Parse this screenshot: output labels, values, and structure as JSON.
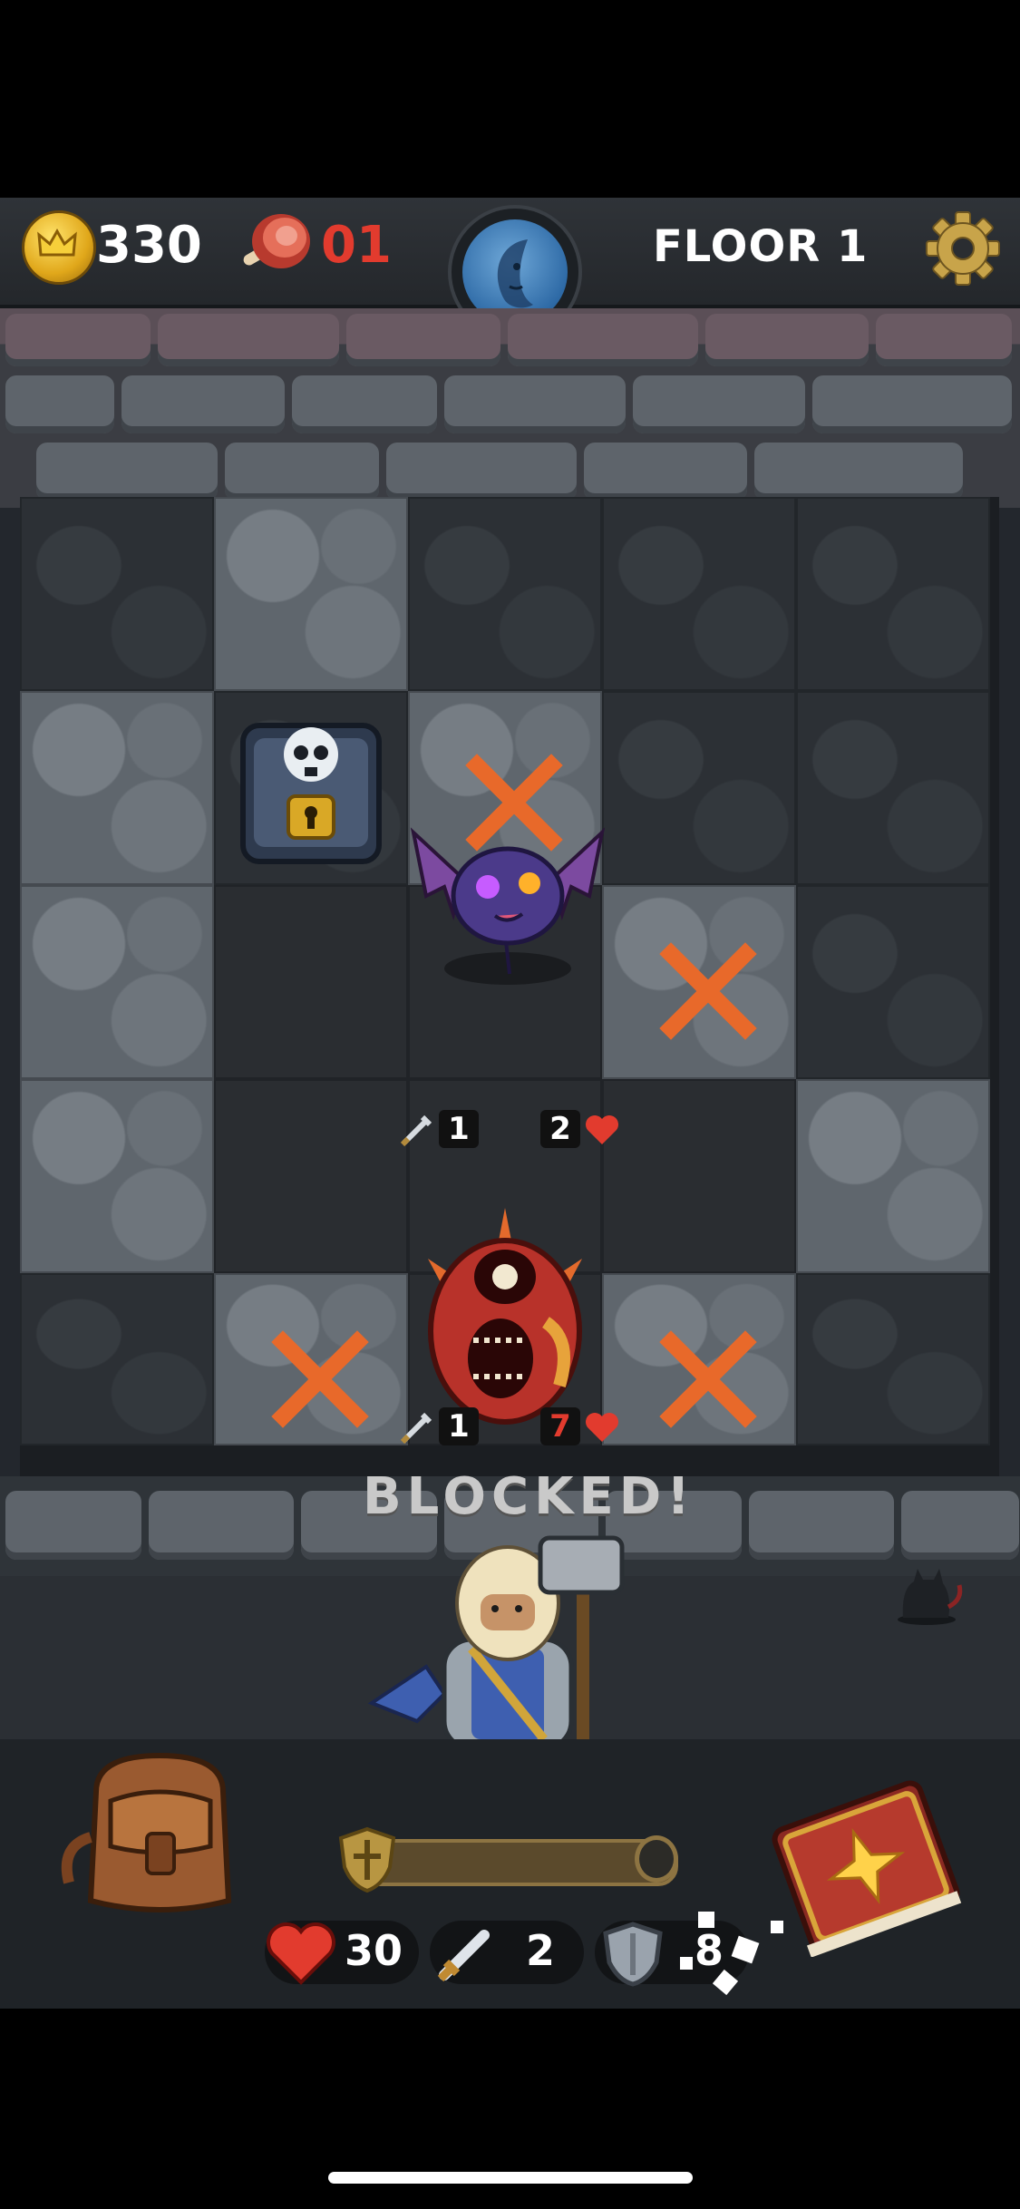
{
  "hud": {
    "gold": "330",
    "food": "01",
    "floor_label": "FLOOR 1"
  },
  "board": {
    "status_text": "BLOCKED!",
    "bat": {
      "attack": "1",
      "health": "2"
    },
    "slime": {
      "attack": "1",
      "health": "7"
    }
  },
  "player": {
    "health": "30",
    "attack": "2",
    "armor": "8"
  },
  "colors": {
    "health_red": "#e23b2e",
    "danger_x": "#e8692a",
    "background": "#23272d"
  },
  "icons": [
    "crown-coin-icon",
    "meat-icon",
    "moon-face-icon",
    "gear-icon",
    "treasure-chest-icon",
    "bat-enemy-icon",
    "slime-enemy-icon",
    "hero-icon",
    "backpack-icon",
    "spellbook-icon",
    "heart-icon",
    "sword-icon",
    "shield-icon"
  ]
}
